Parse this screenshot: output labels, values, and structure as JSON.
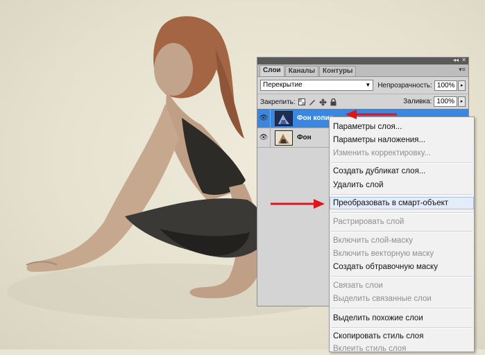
{
  "panel": {
    "tabs": [
      {
        "label": "Слои",
        "active": true
      },
      {
        "label": "Каналы",
        "active": false
      },
      {
        "label": "Контуры",
        "active": false
      }
    ],
    "blend_mode": "Перекрытие",
    "opacity_label": "Непрозрачность:",
    "opacity_value": "100%",
    "lock_label": "Закрепить:",
    "fill_label": "Заливка:",
    "fill_value": "100%",
    "layers": [
      {
        "name": "Фон копия",
        "selected": true
      },
      {
        "name": "Фон",
        "selected": false
      }
    ]
  },
  "context_menu": {
    "items": [
      {
        "label": "Параметры слоя...",
        "enabled": true
      },
      {
        "label": "Параметры наложения...",
        "enabled": true
      },
      {
        "label": "Изменить корректировку...",
        "enabled": false
      },
      {
        "label": "Создать дубликат слоя...",
        "enabled": true
      },
      {
        "label": "Удалить слой",
        "enabled": true
      },
      {
        "label": "Преобразовать в смарт-объект",
        "enabled": true,
        "highlighted": true
      },
      {
        "label": "Растрировать слой",
        "enabled": false
      },
      {
        "label": "Включить слой-маску",
        "enabled": false
      },
      {
        "label": "Включить векторную маску",
        "enabled": false
      },
      {
        "label": "Создать обтравочную маску",
        "enabled": true
      },
      {
        "label": "Связать слои",
        "enabled": false
      },
      {
        "label": "Выделить связанные слои",
        "enabled": false
      },
      {
        "label": "Выделить похожие слои",
        "enabled": true
      },
      {
        "label": "Скопировать стиль слоя",
        "enabled": true
      },
      {
        "label": "Вклеить стиль слоя",
        "enabled": false
      }
    ]
  },
  "colors": {
    "selection": "#3b87e0",
    "annotation_arrow": "#e0141c"
  }
}
